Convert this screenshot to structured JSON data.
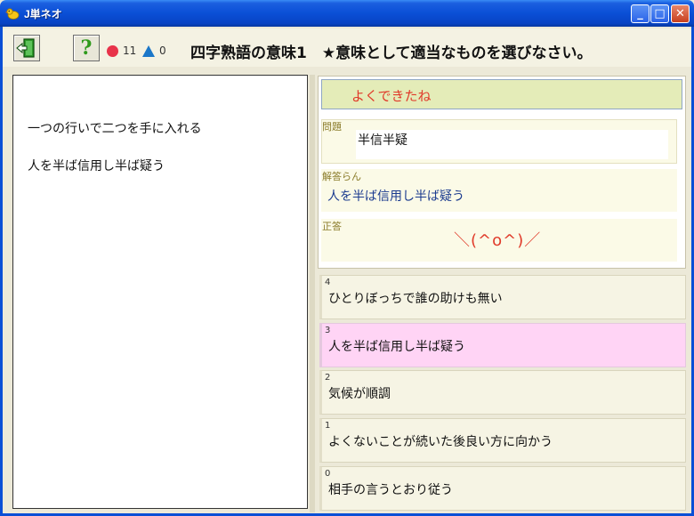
{
  "window": {
    "title": "J単ネオ"
  },
  "titlebar_buttons": {
    "minimize": "_",
    "maximize": "□",
    "close": "✕"
  },
  "toolbar": {
    "help_label": "?",
    "correct_count": "11",
    "wrong_count": "0",
    "quiz_title": "四字熟語の意味1　★意味として適当なものを選びなさい。"
  },
  "left_panel": {
    "lines": [
      "一つの行いで二つを手に入れる",
      "人を半ば信用し半ば疑う"
    ]
  },
  "result": {
    "feedback": "よくできたね",
    "question_label": "問題",
    "question_text": "半信半疑",
    "answer_label": "解答らん",
    "answer_text": "人を半ば信用し半ば疑う",
    "correct_label": "正答",
    "correct_text": "＼(^o^)／"
  },
  "choices": [
    {
      "num": "4",
      "text": "ひとりぼっちで誰の助けも無い",
      "selected": false
    },
    {
      "num": "3",
      "text": "人を半ば信用し半ば疑う",
      "selected": true
    },
    {
      "num": "2",
      "text": "気候が順調",
      "selected": false
    },
    {
      "num": "1",
      "text": "よくないことが続いた後良い方に向かう",
      "selected": false
    },
    {
      "num": "0",
      "text": "相手の言うとおり従う",
      "selected": false
    }
  ],
  "colors": {
    "correct_marker": "#e8334a",
    "wrong_marker": "#1b77c8",
    "selected_choice": "#ffd4f5",
    "feedback_text": "#e03a2a"
  }
}
